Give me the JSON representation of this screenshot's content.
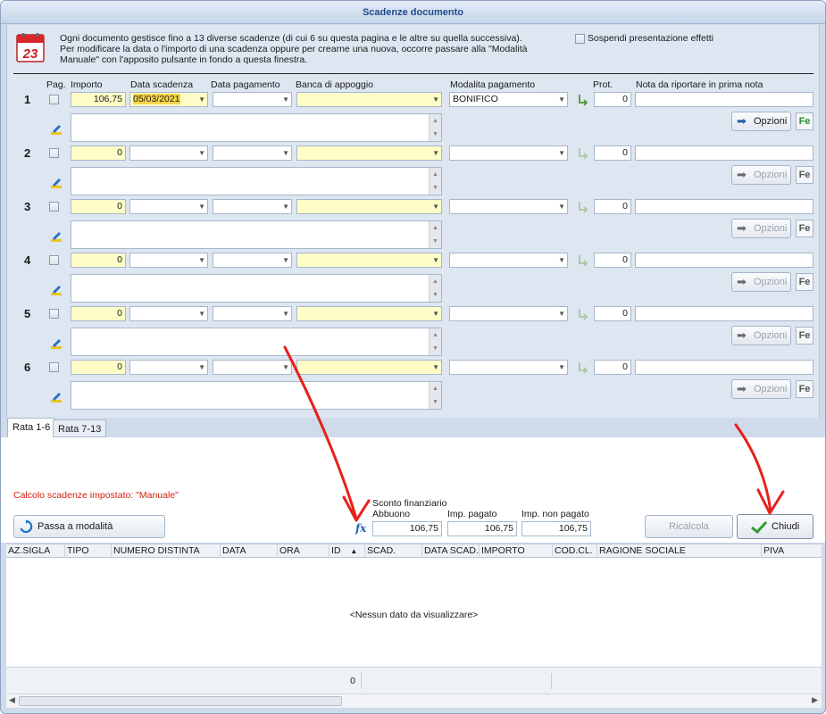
{
  "window": {
    "title": "Scadenze documento"
  },
  "info": {
    "line1": "Ogni documento gestisce fino a 13 diverse scadenze (di cui 6 su questa pagina e le altre su quella successiva).",
    "line2": "Per modificare la data o l'importo di una scadenza oppure per crearne una nuova, occorre passare alla \"Modalità",
    "line3": "Manuale\" con l'apposito pulsante in fondo a questa finestra."
  },
  "suspend_label": "Sospendi presentazione effetti",
  "headers": {
    "pag": "Pag.",
    "importo": "Importo",
    "data_scadenza": "Data scadenza",
    "data_pagamento": "Data pagamento",
    "banca": "Banca di appoggio",
    "modalita": "Modalita pagamento",
    "prot": "Prot.",
    "nota": "Nota da riportare in prima nota"
  },
  "rows": [
    {
      "num": "1",
      "importo": "106,75",
      "data_scadenza": "05/03/2021",
      "modalita": "BONIFICO",
      "prot": "0",
      "opzioni": "Opzioni",
      "fe": "Fe"
    },
    {
      "num": "2",
      "importo": "0",
      "data_scadenza": "",
      "modalita": "",
      "prot": "0",
      "opzioni": "Opzioni",
      "fe": "Fe"
    },
    {
      "num": "3",
      "importo": "0",
      "data_scadenza": "",
      "modalita": "",
      "prot": "0",
      "opzioni": "Opzioni",
      "fe": "Fe"
    },
    {
      "num": "4",
      "importo": "0",
      "data_scadenza": "",
      "modalita": "",
      "prot": "0",
      "opzioni": "Opzioni",
      "fe": "Fe"
    },
    {
      "num": "5",
      "importo": "0",
      "data_scadenza": "",
      "modalita": "",
      "prot": "0",
      "opzioni": "Opzioni",
      "fe": "Fe"
    },
    {
      "num": "6",
      "importo": "0",
      "data_scadenza": "",
      "modalita": "",
      "prot": "0",
      "opzioni": "Opzioni",
      "fe": "Fe"
    }
  ],
  "tabs": [
    "Rata 1-6",
    "Rata 7-13"
  ],
  "calc_label": "Calcolo scadenze impostato: \"Manuale\"",
  "mode_button": "Passa a modalità \"Automatica\"",
  "sconto": {
    "title": "Sconto finanziario",
    "abbuono_label": "Abbuono",
    "abbuono": "106,75",
    "imp_pagato_label": "Imp. pagato",
    "imp_pagato": "106,75",
    "imp_non_pagato_label": "Imp. non pagato",
    "imp_non_pagato": "106,75",
    "fx": "fx"
  },
  "buttons": {
    "ricalcola": "Ricalcola scadenze",
    "chiudi": "Chiudi"
  },
  "grid": {
    "columns": [
      "AZ.SIGLA",
      "TIPO",
      "NUMERO DISTINTA",
      "DATA",
      "ORA",
      "ID",
      "SCAD. MESE",
      "DATA SCAD.",
      "IMPORTO SCAD.",
      "COD.CL.",
      "RAGIONE SOCIALE",
      "PIVA"
    ],
    "empty": "<Nessun dato da visualizzare>",
    "footer_count": "0"
  },
  "colors": {
    "annotation": "#e8201a",
    "accent": "#1f4a8a",
    "warning": "#d3200f"
  }
}
